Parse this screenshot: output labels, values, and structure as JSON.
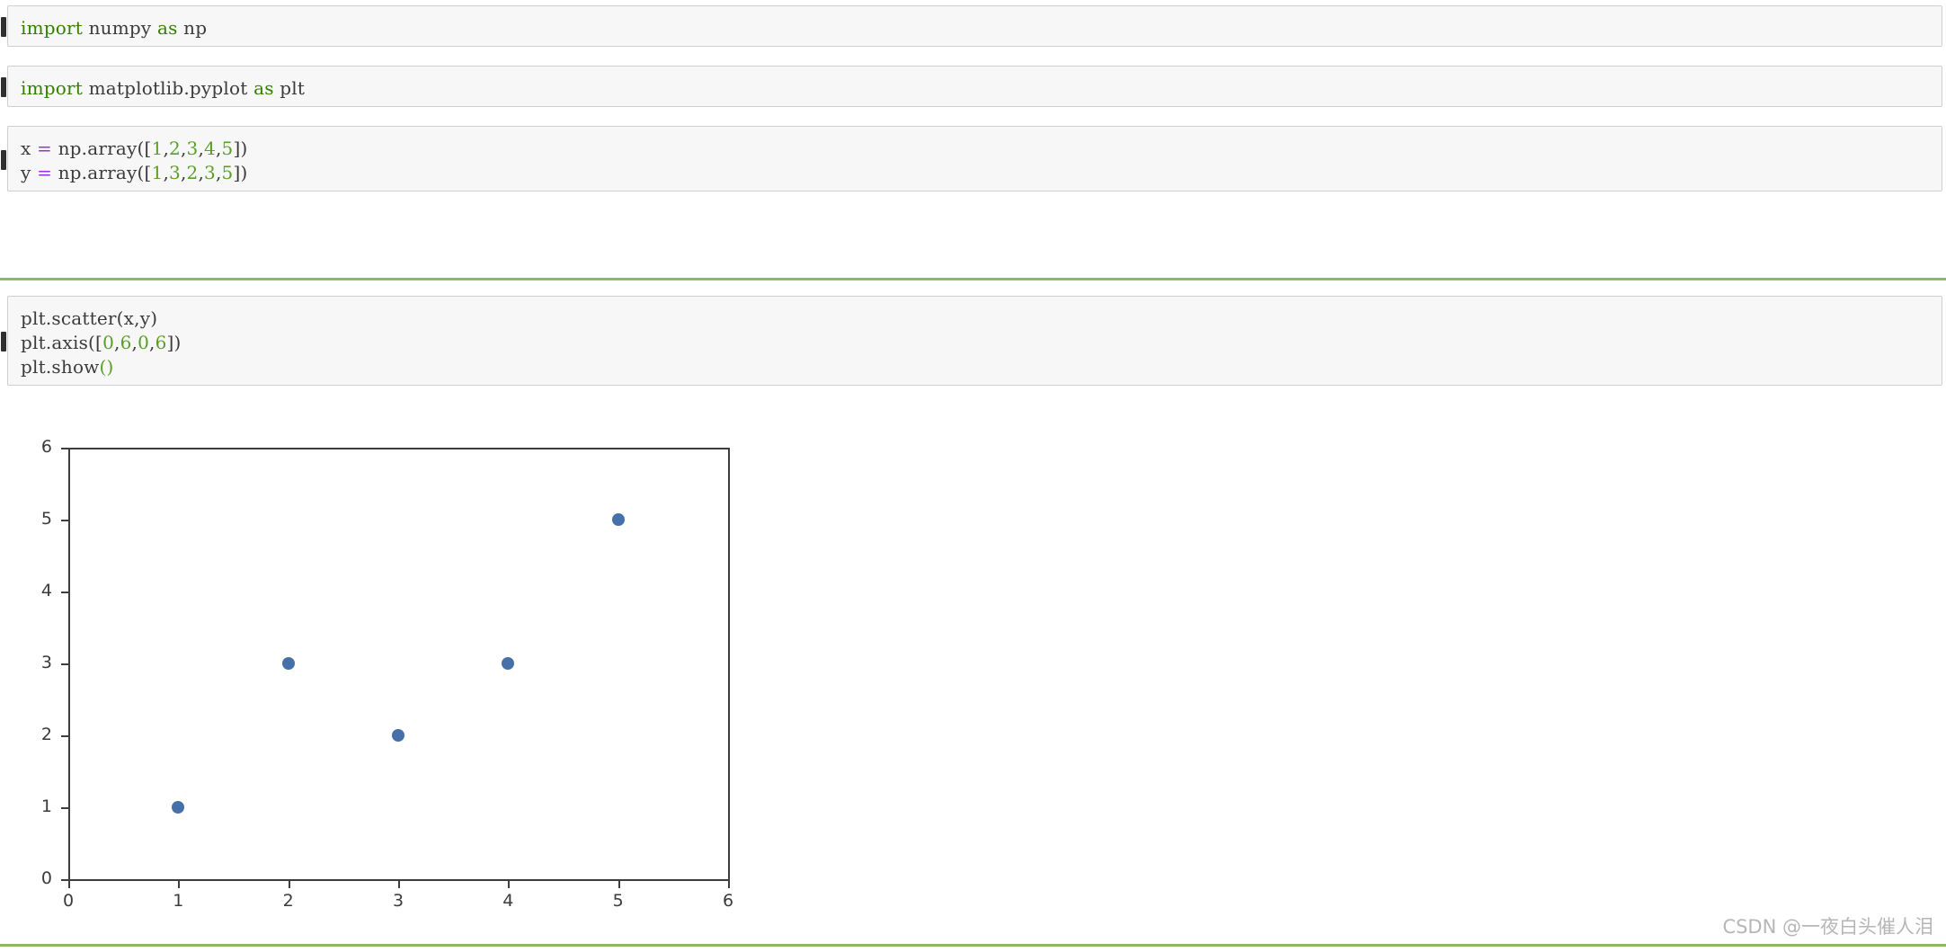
{
  "notebook": {
    "cells": [
      {
        "id": "cell-import-numpy",
        "lines": [
          [
            {
              "t": "import",
              "c": "kw"
            },
            {
              "t": " numpy ",
              "c": ""
            },
            {
              "t": "as",
              "c": "kw"
            },
            {
              "t": " np",
              "c": ""
            }
          ]
        ]
      },
      {
        "id": "cell-import-pyplot",
        "lines": [
          [
            {
              "t": "import",
              "c": "kw"
            },
            {
              "t": " matplotlib.pyplot ",
              "c": ""
            },
            {
              "t": "as",
              "c": "kw"
            },
            {
              "t": " plt",
              "c": ""
            }
          ]
        ]
      },
      {
        "id": "cell-define-arrays",
        "lines": [
          [
            {
              "t": "x ",
              "c": ""
            },
            {
              "t": "=",
              "c": "op"
            },
            {
              "t": " np.array([",
              "c": ""
            },
            {
              "t": "1",
              "c": "num"
            },
            {
              "t": ",",
              "c": ""
            },
            {
              "t": "2",
              "c": "num"
            },
            {
              "t": ",",
              "c": ""
            },
            {
              "t": "3",
              "c": "num"
            },
            {
              "t": ",",
              "c": ""
            },
            {
              "t": "4",
              "c": "num"
            },
            {
              "t": ",",
              "c": ""
            },
            {
              "t": "5",
              "c": "num"
            },
            {
              "t": "])",
              "c": ""
            }
          ],
          [
            {
              "t": "y ",
              "c": ""
            },
            {
              "t": "=",
              "c": "op"
            },
            {
              "t": " np.array([",
              "c": ""
            },
            {
              "t": "1",
              "c": "num"
            },
            {
              "t": ",",
              "c": ""
            },
            {
              "t": "3",
              "c": "num"
            },
            {
              "t": ",",
              "c": ""
            },
            {
              "t": "2",
              "c": "num"
            },
            {
              "t": ",",
              "c": ""
            },
            {
              "t": "3",
              "c": "num"
            },
            {
              "t": ",",
              "c": ""
            },
            {
              "t": "5",
              "c": "num"
            },
            {
              "t": "])",
              "c": ""
            }
          ]
        ]
      },
      {
        "id": "cell-plot",
        "lines": [
          [
            {
              "t": "plt.scatter(x,y)",
              "c": ""
            }
          ],
          [
            {
              "t": "plt.axis([",
              "c": ""
            },
            {
              "t": "0",
              "c": "num"
            },
            {
              "t": ",",
              "c": ""
            },
            {
              "t": "6",
              "c": "num"
            },
            {
              "t": ",",
              "c": ""
            },
            {
              "t": "0",
              "c": "num"
            },
            {
              "t": ",",
              "c": ""
            },
            {
              "t": "6",
              "c": "num"
            },
            {
              "t": "])",
              "c": ""
            }
          ],
          [
            {
              "t": "plt.show",
              "c": ""
            },
            {
              "t": "()",
              "c": "paren-g"
            }
          ]
        ]
      }
    ]
  },
  "chart_data": {
    "type": "scatter",
    "title": "",
    "xlabel": "",
    "ylabel": "",
    "xlim": [
      0,
      6
    ],
    "ylim": [
      0,
      6
    ],
    "xticks": [
      0,
      1,
      2,
      3,
      4,
      5,
      6
    ],
    "yticks": [
      0,
      1,
      2,
      3,
      4,
      5,
      6
    ],
    "xticklabels": [
      "0",
      "1",
      "2",
      "3",
      "4",
      "5",
      "6"
    ],
    "yticklabels": [
      "0",
      "1",
      "2",
      "3",
      "4",
      "5",
      "6"
    ],
    "grid": false,
    "legend": false,
    "marker_color": "#4571a8",
    "series": [
      {
        "name": "scatter",
        "x": [
          1,
          2,
          3,
          4,
          5
        ],
        "y": [
          1,
          3,
          2,
          3,
          5
        ]
      }
    ]
  },
  "watermark": {
    "text": "CSDN @一夜白头催人泪"
  },
  "colors": {
    "cell_background": "#f7f7f7",
    "cell_border": "#cfcfcf",
    "selection_bar": "#2f2f2f",
    "separator_green": "#8cba63",
    "keyword_green": "#338000",
    "number_green": "#5a9e28",
    "operator_purple": "#9b30d9",
    "marker_blue": "#4571a8",
    "axis_gray": "#3d3d3d",
    "watermark_gray": "#b6b6b6"
  }
}
